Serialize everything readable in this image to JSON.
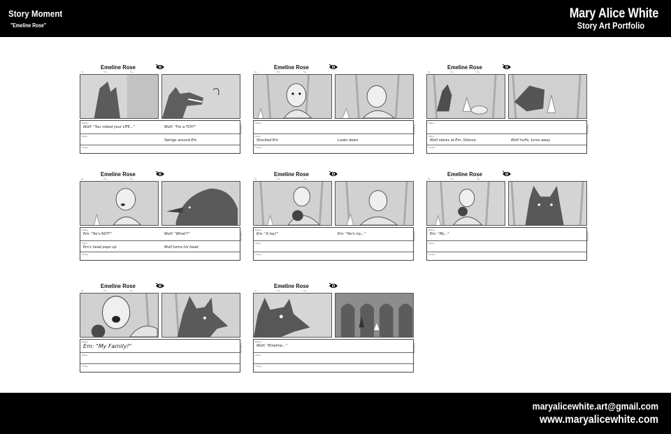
{
  "header": {
    "category": "Story Moment",
    "subtitle": "\"Emeline Rose\"",
    "artist": "Mary Alice White",
    "portfolio": "Story Art Portfolio"
  },
  "footer": {
    "email": "maryalicewhite.art@gmail.com",
    "website": "www.maryalicewhite.com"
  },
  "sheet_labels": {
    "title": "Emeline Rose",
    "sc": "Sc.",
    "pnl": "Pnl.",
    "sq": "Sq.",
    "dialog": "Dialog",
    "action": "Action",
    "timing": "Timing",
    "production": "Production"
  },
  "sheets": [
    {
      "dialog_left": "Wolf: \"You risked your LIFE...\"",
      "dialog_right": "Wolf: \"For a TOY!\"",
      "action_left": "",
      "action_right": "Swings around Em"
    },
    {
      "dialog_left": "",
      "dialog_right": "",
      "action_left": "Shocked Em",
      "action_right": "Looks down"
    },
    {
      "dialog_left": "",
      "dialog_right": "",
      "action_left": "Wolf stares at Em. Silence.",
      "action_right": "Wolf huffs, turns away"
    },
    {
      "dialog_left": "Em: \"He's NOT!\"",
      "dialog_right": "Wolf: \"What?!\"",
      "action_left": "Em's head pops up",
      "action_right": "Wolf turns his head"
    },
    {
      "dialog_left": "Em: \"A toy!\"",
      "dialog_right": "Em: \"He's my...\"",
      "action_left": "",
      "action_right": ""
    },
    {
      "dialog_left": "Em: \"My...\"",
      "dialog_right": "",
      "action_left": "",
      "action_right": ""
    },
    {
      "dialog_left": "Em: \"My Family!\"",
      "dialog_right": "",
      "action_left": "",
      "action_right": ""
    },
    {
      "dialog_left": "Wolf: \"Emeline...\"",
      "dialog_right": "",
      "action_left": "",
      "action_right": ""
    }
  ]
}
